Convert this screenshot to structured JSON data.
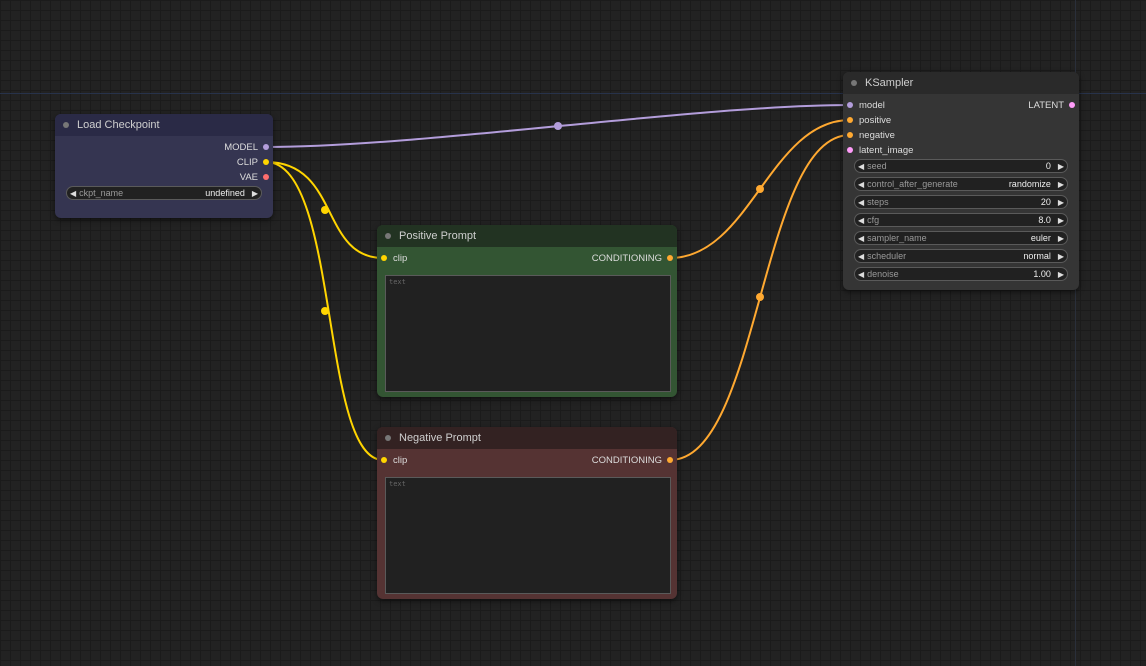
{
  "nodes": {
    "load_checkpoint": {
      "title": "Load Checkpoint",
      "outputs": [
        "MODEL",
        "CLIP",
        "VAE"
      ],
      "widget": {
        "label": "ckpt_name",
        "value": "undefined"
      }
    },
    "positive_prompt": {
      "title": "Positive Prompt",
      "input": "clip",
      "output": "CONDITIONING",
      "text_placeholder": "text"
    },
    "negative_prompt": {
      "title": "Negative Prompt",
      "input": "clip",
      "output": "CONDITIONING",
      "text_placeholder": "text"
    },
    "ksampler": {
      "title": "KSampler",
      "inputs": [
        "model",
        "positive",
        "negative",
        "latent_image"
      ],
      "output": "LATENT",
      "widgets": [
        {
          "label": "seed",
          "value": "0"
        },
        {
          "label": "control_after_generate",
          "value": "randomize"
        },
        {
          "label": "steps",
          "value": "20"
        },
        {
          "label": "cfg",
          "value": "8.0"
        },
        {
          "label": "sampler_name",
          "value": "euler"
        },
        {
          "label": "scheduler",
          "value": "normal"
        },
        {
          "label": "denoise",
          "value": "1.00"
        }
      ]
    }
  },
  "colors": {
    "model": "#b39ddb",
    "clip": "#ffd500",
    "conditioning": "#ffa931",
    "vae": "#ff6e6e",
    "latent": "#ff9cf9"
  },
  "icons": {
    "left_arrow": "◀",
    "right_arrow": "▶"
  }
}
